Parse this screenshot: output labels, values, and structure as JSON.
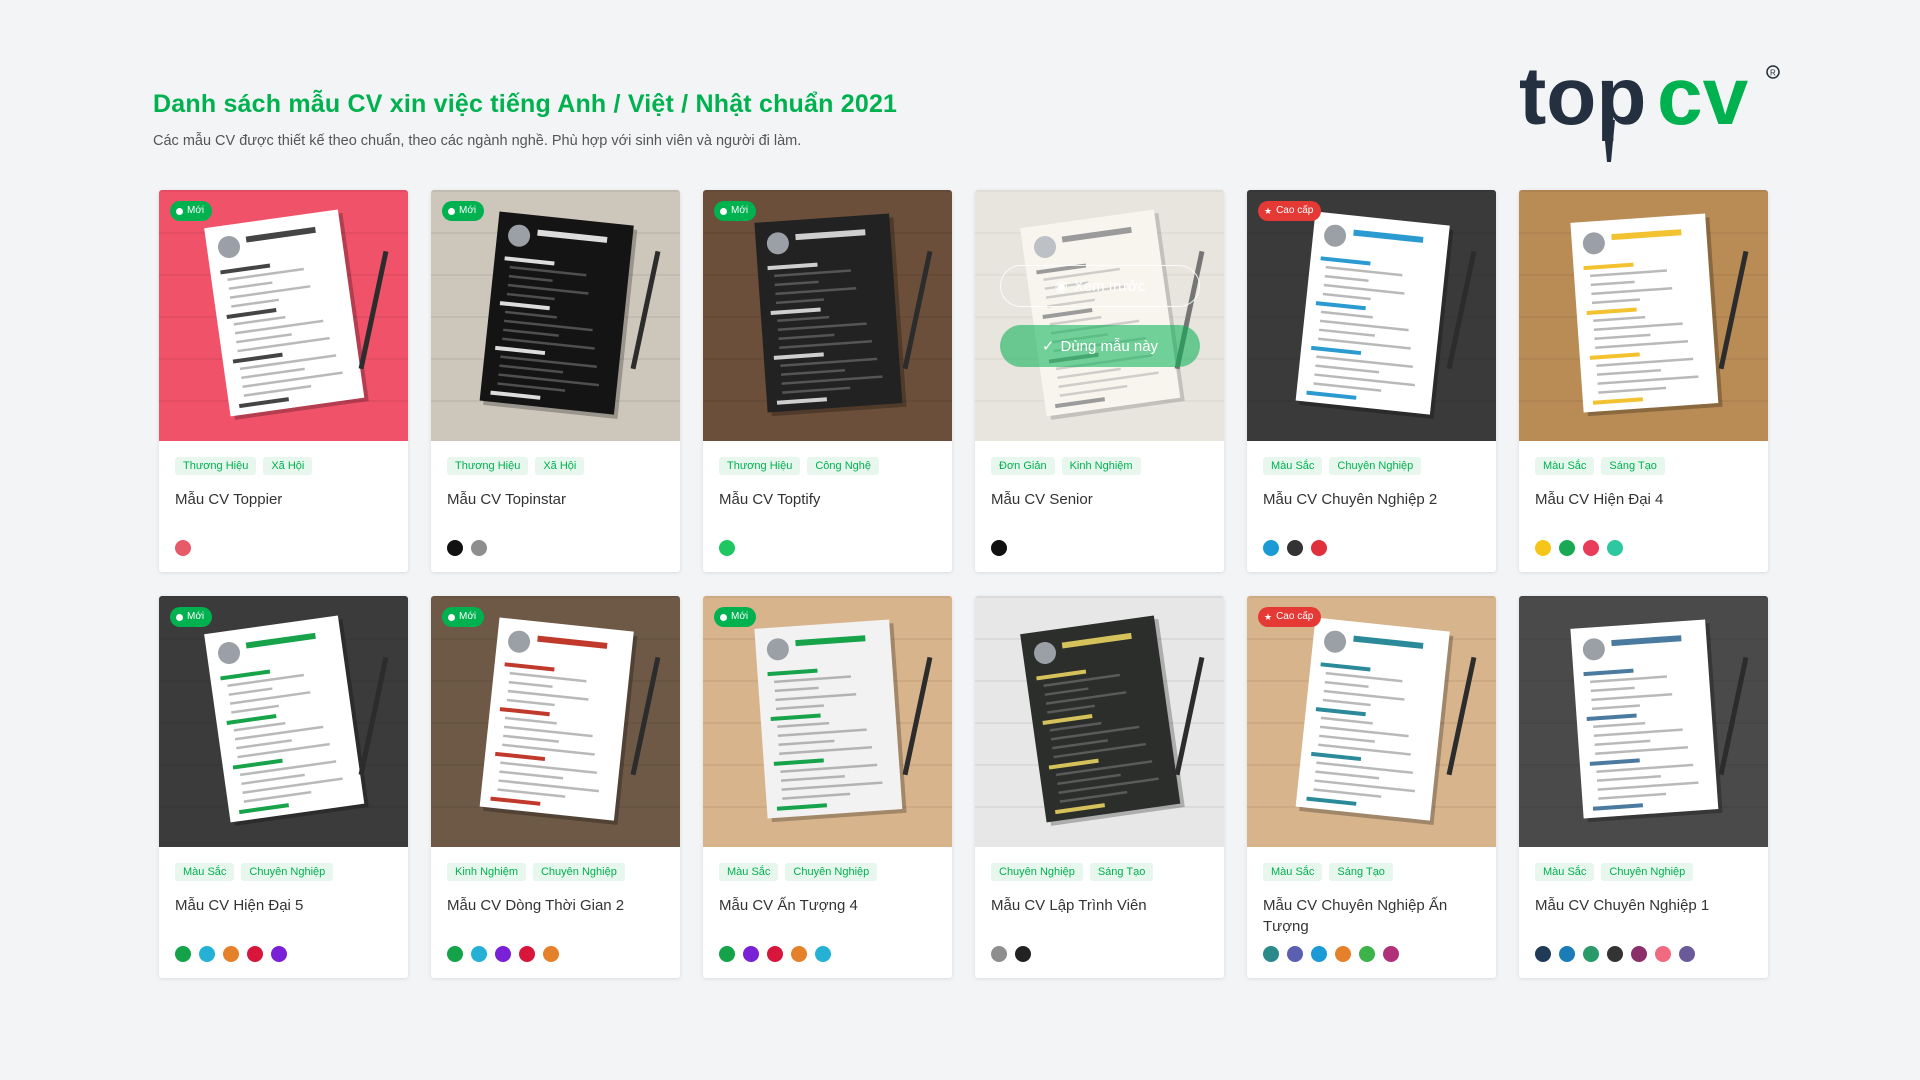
{
  "header": {
    "title": "Danh sách mẫu CV xin việc tiếng Anh / Việt / Nhật chuẩn 2021",
    "subtitle": "Các mẫu CV được thiết kế theo chuẩn, theo các ngành nghề. Phù hợp với sinh viên và người đi làm."
  },
  "logo": {
    "text_top": "top",
    "text_cv": "cv",
    "dark": "#24303f",
    "green": "#00b14f"
  },
  "badges": {
    "new": "Mới",
    "premium": "Cao cấp"
  },
  "hover": {
    "preview": "Xem trước",
    "use": "Dùng mẫu này"
  },
  "templates": [
    {
      "name": "Mẫu CV Toppier",
      "tags": [
        "Thương Hiệu",
        "Xã Hội"
      ],
      "badge": "new",
      "colors": [
        "#e75a6a"
      ],
      "bg": "#f0526a",
      "paper": "#ffffff",
      "ink": "#444"
    },
    {
      "name": "Mẫu CV Topinstar",
      "tags": [
        "Thương Hiệu",
        "Xã Hội"
      ],
      "badge": "new",
      "colors": [
        "#111111",
        "#8e8e8e"
      ],
      "bg": "#cdc6bb",
      "paper": "#141414",
      "ink": "#ddd"
    },
    {
      "name": "Mẫu CV Toptify",
      "tags": [
        "Thương Hiệu",
        "Công Nghệ"
      ],
      "badge": "new",
      "colors": [
        "#1ec760"
      ],
      "bg": "#6b4f3a",
      "paper": "#222222",
      "ink": "#cfcfcf"
    },
    {
      "name": "Mẫu CV Senior",
      "tags": [
        "Đơn Giản",
        "Kinh Nghiệm"
      ],
      "badge": "",
      "colors": [
        "#111111"
      ],
      "bg": "#dcd6cd",
      "paper": "#f4f0e6",
      "ink": "#666"
    },
    {
      "name": "Mẫu CV Chuyên Nghiệp 2",
      "tags": [
        "Màu Sắc",
        "Chuyên Nghiệp"
      ],
      "badge": "premium",
      "colors": [
        "#1c9ad6",
        "#333333",
        "#e0303b"
      ],
      "bg": "#3a3a3a",
      "paper": "#ffffff",
      "ink": "#2a9ad0"
    },
    {
      "name": "Mẫu CV Hiện Đại 4",
      "tags": [
        "Màu Sắc",
        "Sáng Tạo"
      ],
      "badge": "",
      "colors": [
        "#f5c518",
        "#19a853",
        "#e93c5a",
        "#2ec7a0"
      ],
      "bg": "#b98c55",
      "paper": "#ffffff",
      "ink": "#f2c230"
    },
    {
      "name": "Mẫu CV Hiện Đại 5",
      "tags": [
        "Màu Sắc",
        "Chuyên Nghiệp"
      ],
      "badge": "new",
      "colors": [
        "#15a34a",
        "#25b0d6",
        "#e6812b",
        "#d8163b",
        "#7a20d6"
      ],
      "bg": "#3b3b3b",
      "paper": "#ffffff",
      "ink": "#16a34a"
    },
    {
      "name": "Mẫu CV Dòng Thời Gian 2",
      "tags": [
        "Kinh Nghiệm",
        "Chuyên Nghiệp"
      ],
      "badge": "new",
      "colors": [
        "#15a34a",
        "#25b0d6",
        "#7a20d6",
        "#d8163b",
        "#e6812b"
      ],
      "bg": "#6e5947",
      "paper": "#ffffff",
      "ink": "#c0392b"
    },
    {
      "name": "Mẫu CV Ấn Tượng 4",
      "tags": [
        "Màu Sắc",
        "Chuyên Nghiệp"
      ],
      "badge": "new",
      "colors": [
        "#15a34a",
        "#7a20d6",
        "#d8163b",
        "#e6812b",
        "#25b0d6"
      ],
      "bg": "#d8b48c",
      "paper": "#f2f2f2",
      "ink": "#16a34a"
    },
    {
      "name": "Mẫu CV Lập Trình Viên",
      "tags": [
        "Chuyên Nghiệp",
        "Sáng Tạo"
      ],
      "badge": "",
      "colors": [
        "#8e8e8e",
        "#222222"
      ],
      "bg": "#e7e7e7",
      "paper": "#2b2e2b",
      "ink": "#d6c25a"
    },
    {
      "name": "Mẫu CV Chuyên Nghiệp Ấn Tượng",
      "tags": [
        "Màu Sắc",
        "Sáng Tạo"
      ],
      "badge": "premium",
      "colors": [
        "#2a8a8a",
        "#5a5fb0",
        "#1c9ad6",
        "#e6812b",
        "#3db34a",
        "#b0307a"
      ],
      "bg": "#d7b48c",
      "paper": "#ffffff",
      "ink": "#2b8a9a"
    },
    {
      "name": "Mẫu CV Chuyên Nghiệp 1",
      "tags": [
        "Màu Sắc",
        "Chuyên Nghiệp"
      ],
      "badge": "",
      "colors": [
        "#1f3b57",
        "#1b7cb8",
        "#2a9a6a",
        "#333333",
        "#8a2f6a",
        "#f06a80",
        "#6a5a9a"
      ],
      "bg": "#4a4a4a",
      "paper": "#ffffff",
      "ink": "#4a7aa0"
    }
  ]
}
